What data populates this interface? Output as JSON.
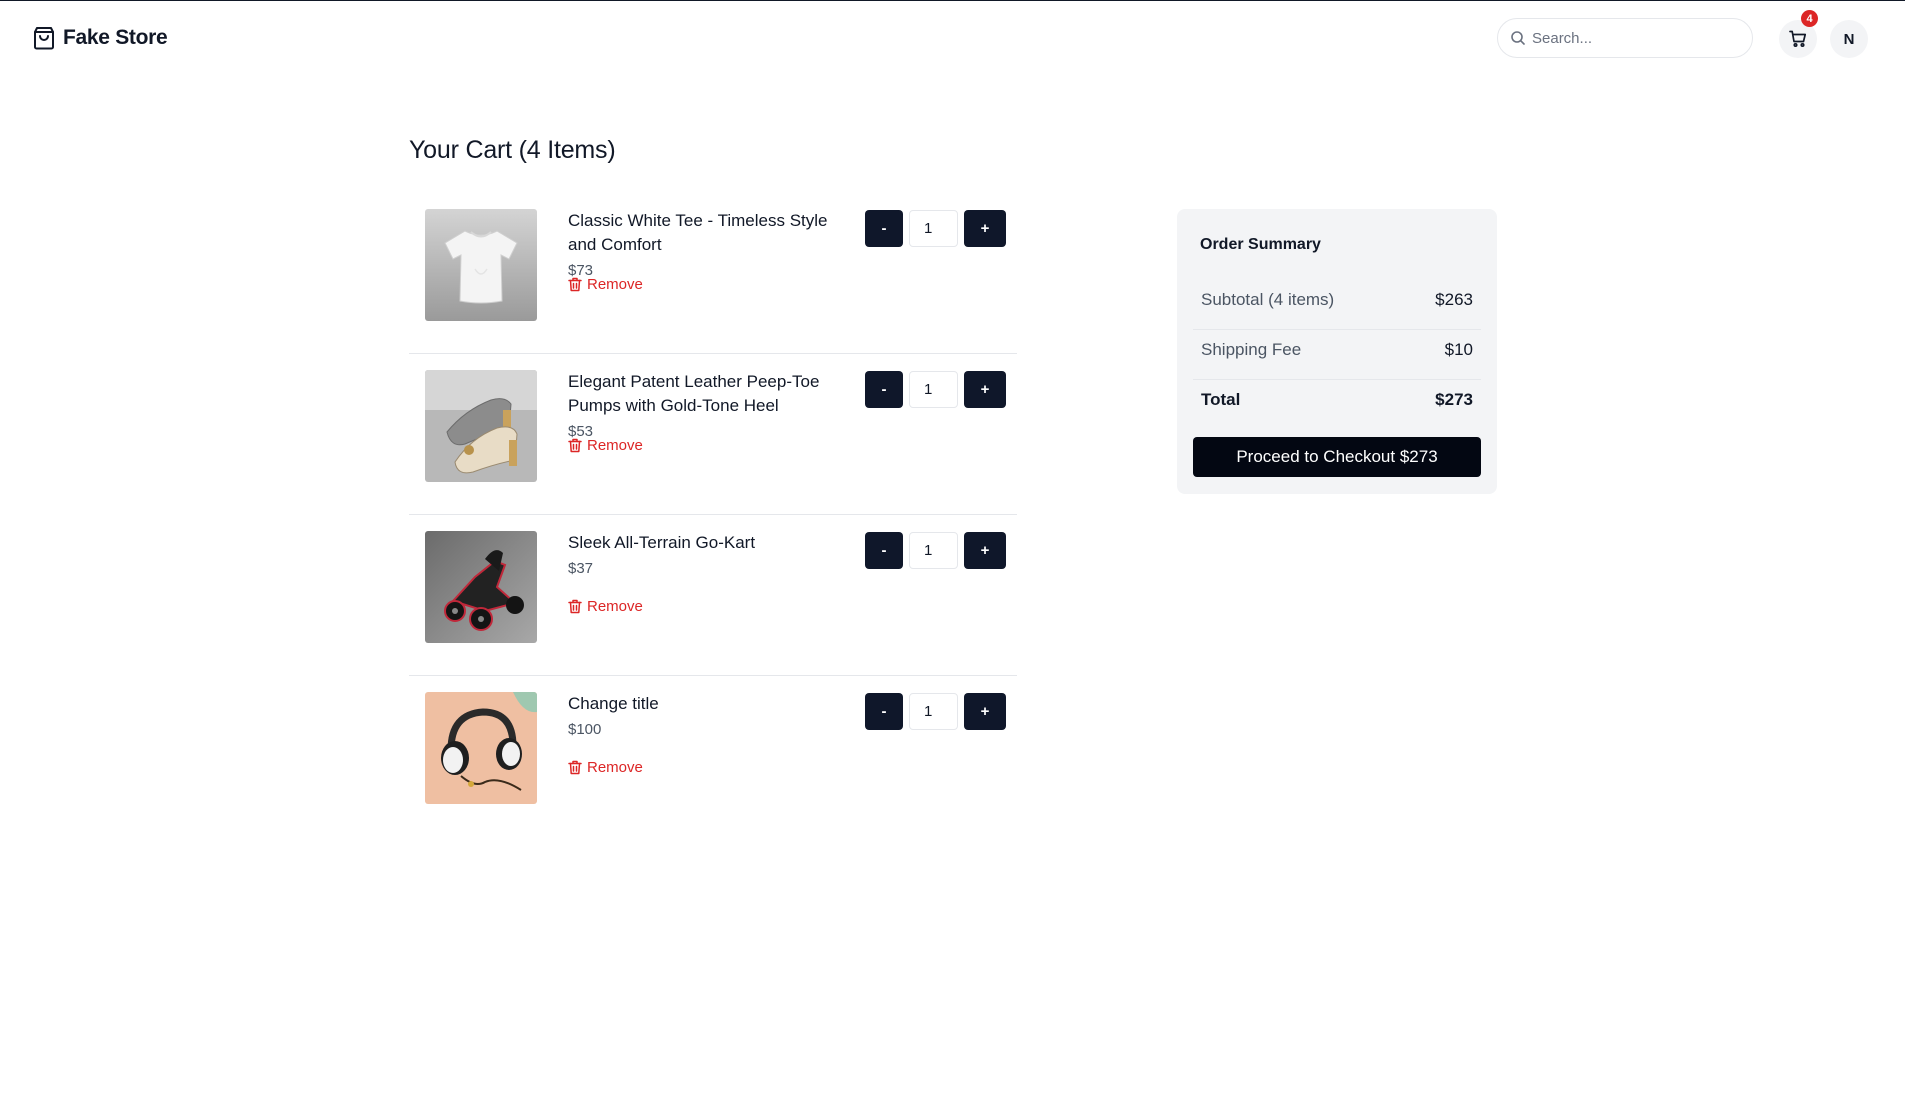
{
  "brand": {
    "name": "Fake Store",
    "icon": "shopping-bag-icon"
  },
  "search": {
    "placeholder": "Search...",
    "value": "",
    "icon": "search-icon"
  },
  "header": {
    "cart_count": "4",
    "cart_icon": "cart-icon",
    "avatar_initial": "N"
  },
  "page": {
    "title": "Your Cart (4 Items)"
  },
  "cart": {
    "remove_label": "Remove",
    "decrement_label": "-",
    "increment_label": "+",
    "items": [
      {
        "title": "Classic White Tee - Timeless Style and Comfort",
        "price": "$73",
        "quantity": "1",
        "image": "white-tshirt-image"
      },
      {
        "title": "Elegant Patent Leather Peep-Toe Pumps with Gold-Tone Heel",
        "price": "$53",
        "quantity": "1",
        "image": "peep-toe-pumps-image"
      },
      {
        "title": "Sleek All-Terrain Go-Kart",
        "price": "$37",
        "quantity": "1",
        "image": "go-kart-image"
      },
      {
        "title": "Change title",
        "price": "$100",
        "quantity": "1",
        "image": "headphones-image"
      }
    ]
  },
  "summary": {
    "title": "Order Summary",
    "subtotal_label": "Subtotal (4 items)",
    "subtotal_value": "$263",
    "shipping_label": "Shipping Fee",
    "shipping_value": "$10",
    "total_label": "Total",
    "total_value": "$273",
    "checkout_label": "Proceed to Checkout $273"
  },
  "colors": {
    "primary": "#0f172a",
    "danger": "#dc2626",
    "badge": "#dc2626",
    "panel": "#f3f4f6"
  }
}
